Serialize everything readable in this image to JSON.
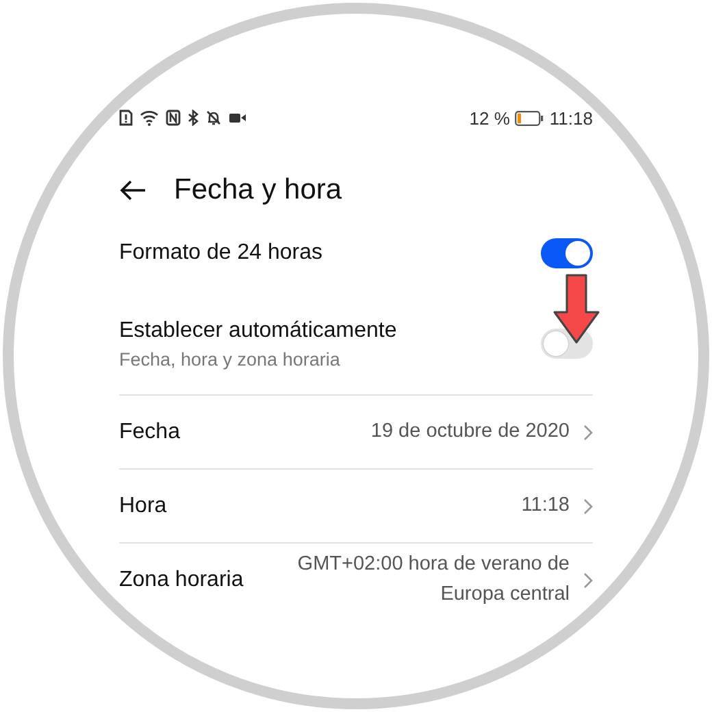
{
  "status_bar": {
    "battery_text": "12 %",
    "time": "11:18"
  },
  "header": {
    "title": "Fecha y hora"
  },
  "settings": [
    {
      "kind": "toggle",
      "label": "Formato de 24 horas",
      "on": true
    },
    {
      "kind": "toggle",
      "label": "Establecer automáticamente",
      "subtitle": "Fecha, hora y zona horaria",
      "on": false
    },
    {
      "kind": "link",
      "label": "Fecha",
      "value": "19 de octubre de 2020"
    },
    {
      "kind": "link",
      "label": "Hora",
      "value": "11:18"
    },
    {
      "kind": "link",
      "label": "Zona horaria",
      "value": "GMT+02:00 hora de verano de Europa central"
    }
  ]
}
